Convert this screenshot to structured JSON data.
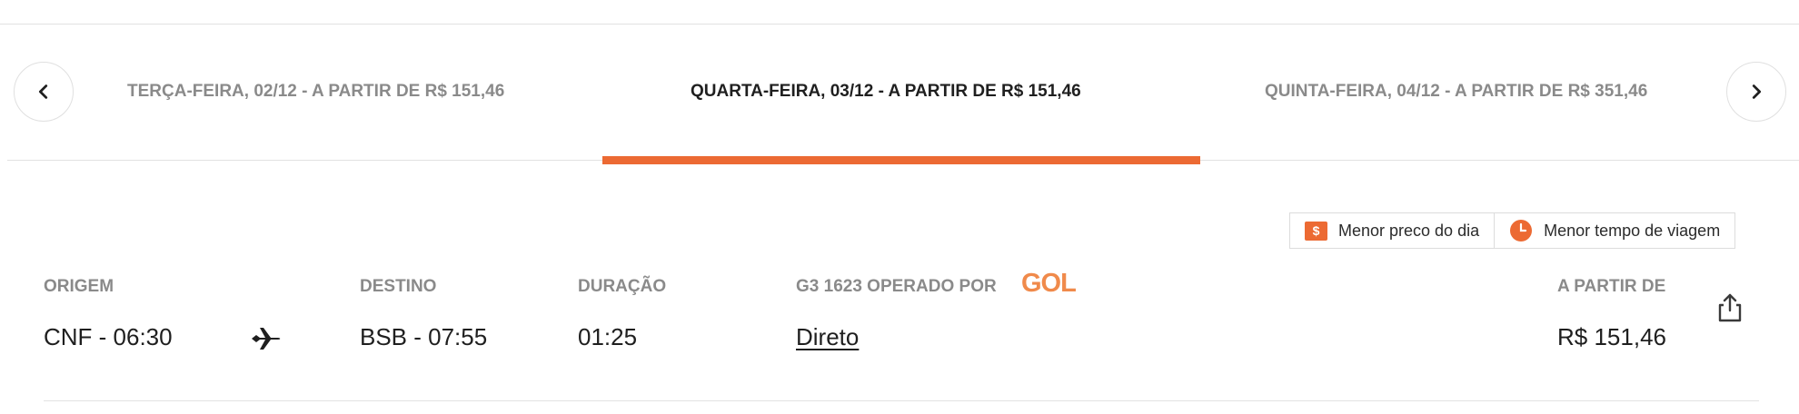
{
  "date_tabs": [
    {
      "label": "TERÇA-FEIRA, 02/12 - A PARTIR DE R$ 151,46",
      "active": false
    },
    {
      "label": "QUARTA-FEIRA, 03/12 - A PARTIR DE R$ 151,46",
      "active": true
    },
    {
      "label": "QUINTA-FEIRA, 04/12 - A PARTIR DE R$ 351,46",
      "active": false
    }
  ],
  "navigation": {
    "prev_icon": "chevron-left-icon",
    "next_icon": "chevron-right-icon"
  },
  "legend": {
    "lowest_price_label": "Menor preco do dia",
    "lowest_price_icon_text": "$",
    "shortest_time_label": "Menor tempo de viagem"
  },
  "flight": {
    "origin_label": "ORIGEM",
    "origin_value": "CNF - 06:30",
    "destination_label": "DESTINO",
    "destination_value": "BSB - 07:55",
    "duration_label": "DURAÇÃO",
    "duration_value": "01:25",
    "flight_label": "G3 1623 OPERADO POR",
    "airline_logo": "GOL",
    "stops_value": "Direto",
    "price_label": "A PARTIR DE",
    "price_value": "R$ 151,46"
  },
  "colors": {
    "accent": "#ec6a33",
    "muted_text": "#8a8a8a",
    "text": "#1f1f1f",
    "divider": "#e2e2e2"
  }
}
